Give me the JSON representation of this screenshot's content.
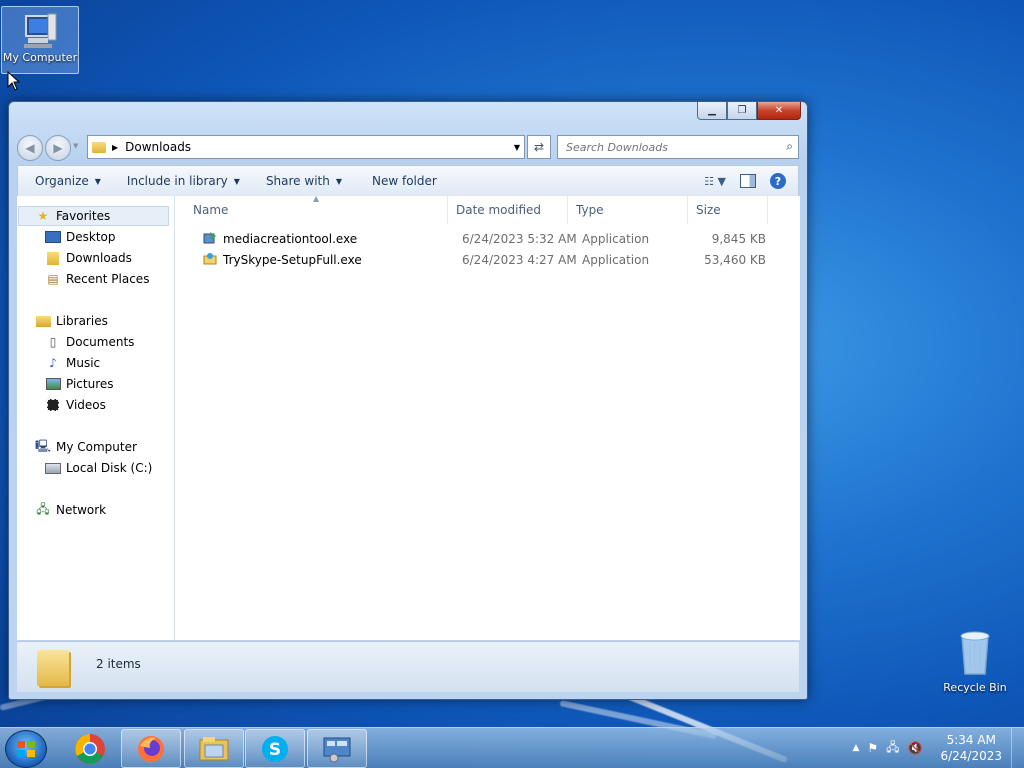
{
  "desktop": {
    "icons": [
      {
        "label": "My Computer"
      },
      {
        "label": "Recycle Bin"
      }
    ]
  },
  "window": {
    "address": {
      "path": "Downloads"
    },
    "search": {
      "placeholder": "Search Downloads"
    },
    "toolbar": {
      "organize": "Organize",
      "include_in_library": "Include in library",
      "share_with": "Share with",
      "new_folder": "New folder"
    },
    "nav": {
      "favorites": "Favorites",
      "desktop": "Desktop",
      "downloads": "Downloads",
      "recent_places": "Recent Places",
      "libraries": "Libraries",
      "documents": "Documents",
      "music": "Music",
      "pictures": "Pictures",
      "videos": "Videos",
      "my_computer": "My Computer",
      "local_disk": "Local Disk (C:)",
      "network": "Network"
    },
    "columns": {
      "name": "Name",
      "date_modified": "Date modified",
      "type": "Type",
      "size": "Size"
    },
    "files": [
      {
        "name": "mediacreationtool.exe",
        "date": "6/24/2023 5:32 AM",
        "type": "Application",
        "size": "9,845 KB"
      },
      {
        "name": "TrySkype-SetupFull.exe",
        "date": "6/24/2023 4:27 AM",
        "type": "Application",
        "size": "53,460 KB"
      }
    ],
    "status": {
      "item_count": "2 items"
    }
  },
  "taskbar": {
    "clock": {
      "time": "5:34 AM",
      "date": "6/24/2023"
    },
    "apps": [
      "chrome-icon",
      "firefox-icon",
      "explorer-icon",
      "skype-icon",
      "control-panel-icon"
    ]
  },
  "colors": {
    "accent": "#2c6bc6",
    "desktop": "#1f73cf"
  }
}
